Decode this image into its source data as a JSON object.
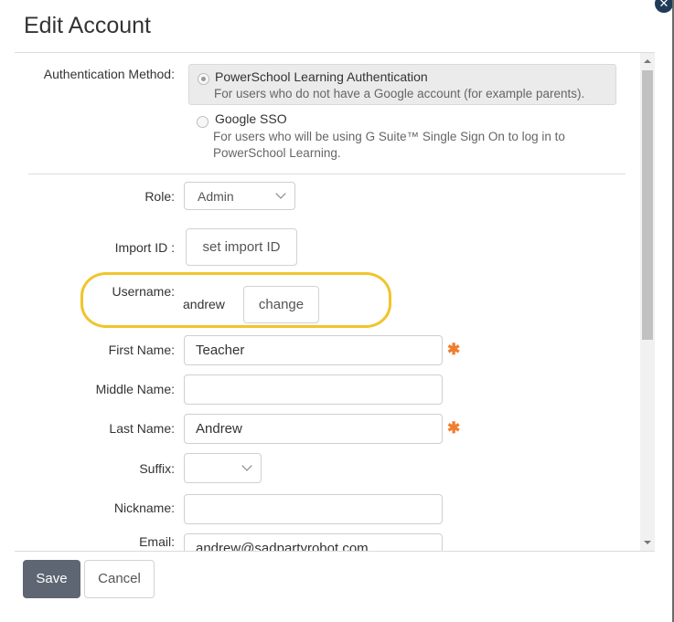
{
  "dialog": {
    "title": "Edit Account",
    "close_symbol": "✕"
  },
  "auth": {
    "label": "Authentication Method:",
    "options": [
      {
        "title": "PowerSchool Learning Authentication",
        "description": "For users who do not have a Google account (for example parents).",
        "selected": true
      },
      {
        "title": "Google SSO",
        "description_line1": "For users who will be using G Suite™ Single Sign On to log in to",
        "description_line2": "PowerSchool Learning.",
        "selected": false
      }
    ]
  },
  "role": {
    "label": "Role:",
    "value": "Admin"
  },
  "import_id": {
    "label": "Import ID :",
    "button": "set import ID"
  },
  "username": {
    "label": "Username:",
    "value": "andrew",
    "button": "change"
  },
  "first_name": {
    "label": "First Name:",
    "value": "Teacher",
    "required_mark": "✱"
  },
  "middle_name": {
    "label": "Middle Name:",
    "value": ""
  },
  "last_name": {
    "label": "Last Name:",
    "value": "Andrew",
    "required_mark": "✱"
  },
  "suffix": {
    "label": "Suffix:",
    "value": ""
  },
  "nickname": {
    "label": "Nickname:",
    "value": ""
  },
  "email": {
    "label": "Email:",
    "value": "andrew@sadpartyrobot.com"
  },
  "footer": {
    "save_label": "Save",
    "cancel_label": "Cancel"
  },
  "colors": {
    "required": "#f07e2d",
    "highlight": "#f2c42a",
    "save_bg": "#5d6672"
  }
}
